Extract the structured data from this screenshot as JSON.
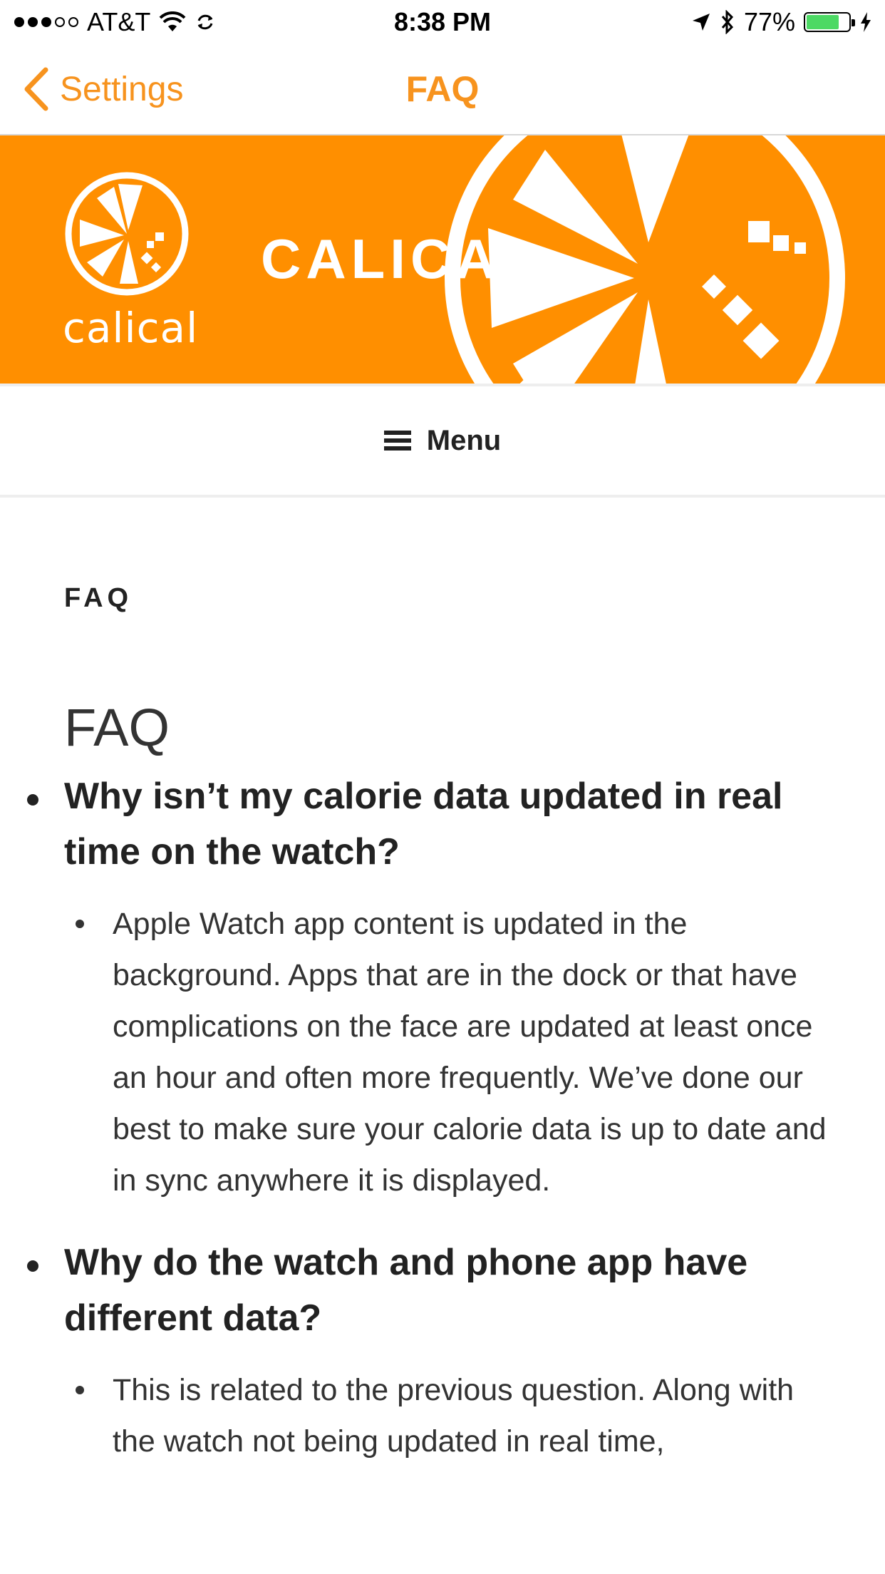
{
  "status_bar": {
    "carrier": "AT&T",
    "time": "8:38 PM",
    "battery_percent": "77%",
    "battery_level": 0.77,
    "battery_color": "#4cd964",
    "icons": [
      "signal-dots-icon",
      "wifi-icon",
      "sync-icon",
      "location-arrow-icon",
      "bluetooth-icon",
      "battery-icon",
      "charging-bolt-icon"
    ]
  },
  "nav": {
    "back_label": "Settings",
    "title": "FAQ",
    "accent_color": "#f7931e"
  },
  "banner": {
    "logo_text": "calical",
    "headline": "CALICA",
    "background_color": "#ff8f00"
  },
  "menu": {
    "label": "Menu",
    "icon": "hamburger-icon"
  },
  "page": {
    "kicker": "FAQ",
    "heading": "FAQ",
    "faqs": [
      {
        "question": "Why isn’t my calorie data updated in real time on the watch?",
        "answer": "Apple Watch app content is updated in the background. Apps that are in the dock or that have complications on the face are updated at least once an hour and often more frequently. We’ve done our best to make sure your calorie data is up to date and in sync anywhere it is displayed."
      },
      {
        "question": "Why do the watch and phone app have different data?",
        "answer": "This is related to the previous question. Along with the watch not being updated in real time,"
      }
    ]
  }
}
